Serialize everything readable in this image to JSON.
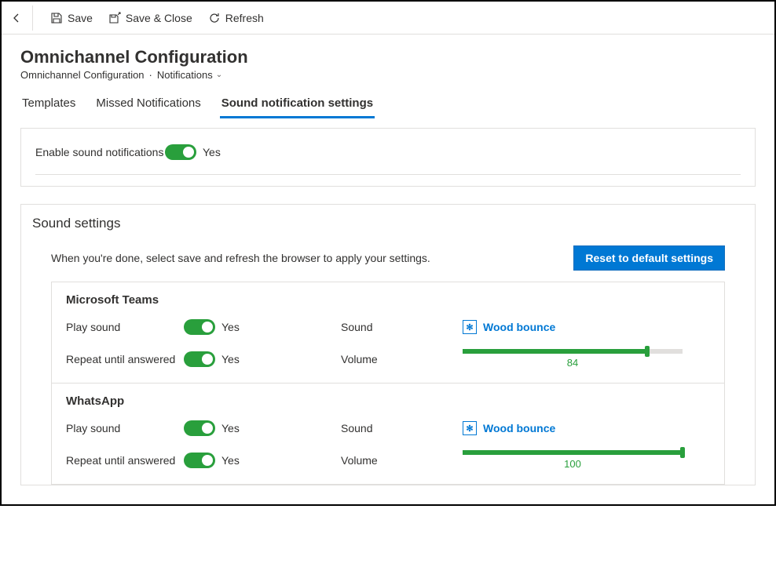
{
  "toolbar": {
    "save": "Save",
    "save_close": "Save & Close",
    "refresh": "Refresh"
  },
  "page": {
    "title": "Omnichannel Configuration",
    "crumb1": "Omnichannel Configuration",
    "crumb2": "Notifications"
  },
  "tabs": {
    "templates": "Templates",
    "missed": "Missed Notifications",
    "sound": "Sound notification settings"
  },
  "enable": {
    "label": "Enable sound notifications",
    "value_text": "Yes"
  },
  "settings": {
    "title": "Sound settings",
    "hint": "When you're done, select save and refresh the browser to apply your settings.",
    "reset": "Reset to default settings"
  },
  "channels": [
    {
      "name": "Microsoft Teams",
      "play_label": "Play sound",
      "play_text": "Yes",
      "sound_label": "Sound",
      "sound_value": "Wood bounce",
      "repeat_label": "Repeat until answered",
      "repeat_text": "Yes",
      "volume_label": "Volume",
      "volume": 84
    },
    {
      "name": "WhatsApp",
      "play_label": "Play sound",
      "play_text": "Yes",
      "sound_label": "Sound",
      "sound_value": "Wood bounce",
      "repeat_label": "Repeat until answered",
      "repeat_text": "Yes",
      "volume_label": "Volume",
      "volume": 100
    }
  ]
}
